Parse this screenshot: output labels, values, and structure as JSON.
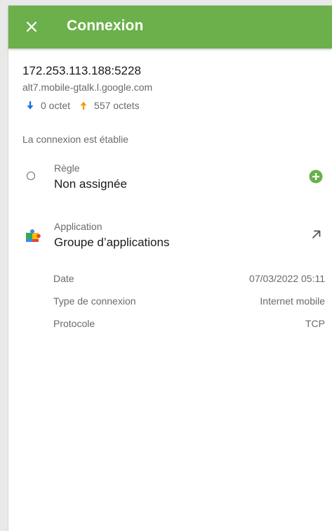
{
  "header": {
    "title": "Connexion",
    "close_icon": "close-icon",
    "bar_color": "#6bb04a"
  },
  "connection": {
    "address": "172.253.113.188:5228",
    "host": "alt7.mobile-gtalk.l.google.com",
    "download": "0 octet",
    "upload": "557 octets",
    "download_icon": "arrow-down-icon",
    "upload_icon": "arrow-up-icon",
    "download_color": "#1a73e8",
    "upload_color": "#f39c12",
    "status": "La connexion est établie"
  },
  "rule": {
    "label": "Règle",
    "value": "Non assignée",
    "add_icon": "add-circle-icon",
    "add_color": "#6bb04a"
  },
  "application": {
    "label": "Application",
    "value": "Groupe d’applications",
    "icon": "app-group-icon",
    "open_icon": "open-external-icon"
  },
  "details": [
    {
      "key": "Date",
      "value": "07/03/2022 05:11"
    },
    {
      "key": "Type de connexion",
      "value": "Internet mobile"
    },
    {
      "key": "Protocole",
      "value": "TCP"
    }
  ]
}
